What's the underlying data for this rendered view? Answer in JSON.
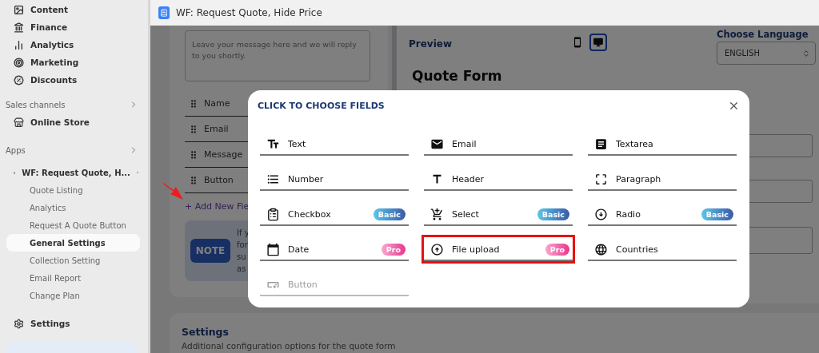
{
  "sidebar": {
    "items": [
      {
        "label": "Content"
      },
      {
        "label": "Finance"
      },
      {
        "label": "Analytics"
      },
      {
        "label": "Marketing"
      },
      {
        "label": "Discounts"
      }
    ],
    "sales_channels": {
      "heading": "Sales channels",
      "items": [
        {
          "label": "Online Store"
        }
      ]
    },
    "apps": {
      "heading": "Apps",
      "app": "WF: Request Quote, H...",
      "items": [
        {
          "label": "Quote Listing",
          "selected": false
        },
        {
          "label": "Analytics",
          "selected": false
        },
        {
          "label": "Request A Quote Button",
          "selected": false
        },
        {
          "label": "General Settings",
          "selected": true
        },
        {
          "label": "Collection Setting",
          "selected": false
        },
        {
          "label": "Email Report",
          "selected": false
        },
        {
          "label": "Change Plan",
          "selected": false
        }
      ]
    },
    "settings": "Settings"
  },
  "top_bar": {
    "title": "WF: Request Quote, Hide Price"
  },
  "form_editor": {
    "message_placeholder": "Leave your message here and we will reply to you shortly.",
    "fields": [
      {
        "label": "Name"
      },
      {
        "label": "Email"
      },
      {
        "label": "Message"
      },
      {
        "label": "Button"
      }
    ],
    "add_field": "+ Add New Fie",
    "note": {
      "badge": "NOTE",
      "lines": [
        "If y",
        "for",
        "su",
        "as"
      ]
    }
  },
  "preview": {
    "title": "Preview",
    "views": [
      {
        "selected": false
      },
      {
        "selected": true
      }
    ],
    "language": {
      "label": "Choose Language",
      "value": "ENGLISH"
    },
    "form_title": "Quote Form"
  },
  "settings_card": {
    "title": "Settings",
    "description": "Additional configuration options for the quote form"
  },
  "modal": {
    "title": "CLICK TO CHOOSE FIELDS",
    "fields": [
      {
        "label": "Text",
        "disabled": false,
        "highlighted": false
      },
      {
        "label": "Email",
        "disabled": false,
        "highlighted": false
      },
      {
        "label": "Textarea",
        "disabled": false,
        "highlighted": false
      },
      {
        "label": "Number",
        "disabled": false,
        "highlighted": false
      },
      {
        "label": "Header",
        "disabled": false,
        "highlighted": false
      },
      {
        "label": "Paragraph",
        "disabled": false,
        "highlighted": false
      },
      {
        "label": "Checkbox",
        "disabled": false,
        "highlighted": false,
        "badge": {
          "label": "Basic",
          "kind": "basic"
        }
      },
      {
        "label": "Select",
        "disabled": false,
        "highlighted": false,
        "badge": {
          "label": "Basic",
          "kind": "basic"
        }
      },
      {
        "label": "Radio",
        "disabled": false,
        "highlighted": false,
        "badge": {
          "label": "Basic",
          "kind": "basic"
        }
      },
      {
        "label": "Date",
        "disabled": false,
        "highlighted": false,
        "badge": {
          "label": "Pro",
          "kind": "pro"
        }
      },
      {
        "label": "File upload",
        "disabled": false,
        "highlighted": true,
        "badge": {
          "label": "Pro",
          "kind": "pro"
        }
      },
      {
        "label": "Countries",
        "disabled": false,
        "highlighted": false
      },
      {
        "label": "Button",
        "disabled": true,
        "highlighted": false
      }
    ]
  }
}
